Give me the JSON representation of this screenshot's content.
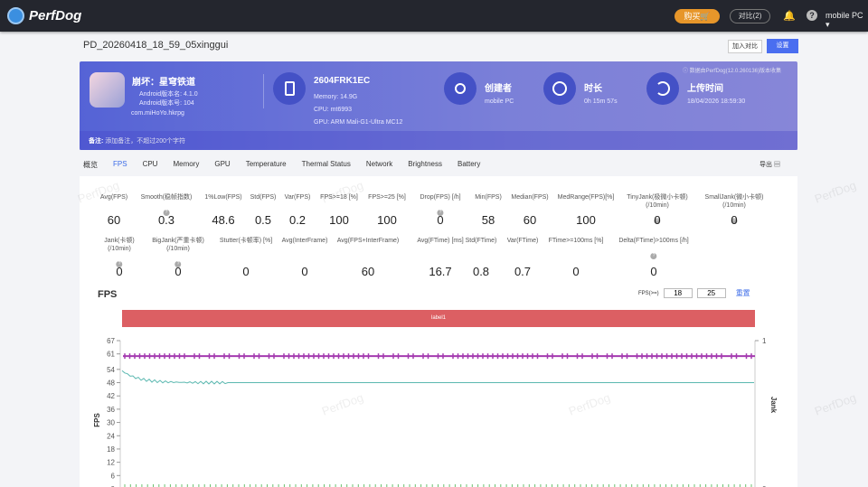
{
  "topbar": {
    "brand": "PerfDog",
    "buy": "购买🛒",
    "compare": "对比(2)",
    "user": "mobile PC ▾"
  },
  "header": {
    "title": "PD_20260418_18_59_05xinggui",
    "add_compare": "加入对比",
    "settings": "设置"
  },
  "banner": {
    "app_name": "崩坏：星穹铁道",
    "android_version_name": "Android版本名: 4.1.0",
    "android_version_code": "Android版本号: 104",
    "package": "com.miHoYo.hkrpg",
    "device": "2604FRK1EC",
    "memory": "Memory: 14.9G",
    "cpu": "CPU: mt6993",
    "gpu": "GPU: ARM Mali-G1-Ultra MC12",
    "creator_label": "创建者",
    "creator": "mobile PC",
    "duration_label": "时长",
    "duration": "0h 15m 57s",
    "upload_label": "上传时间",
    "upload_time": "18/04/2026 18:59:30",
    "version_note": "ⓘ 数据由PerfDog(12.0.260136)版本收集",
    "note_label": "备注:",
    "note_placeholder": "添加备注，不超过200个字符"
  },
  "tabs": [
    "概览",
    "FPS",
    "CPU",
    "Memory",
    "GPU",
    "Temperature",
    "Thermal Status",
    "Network",
    "Brightness",
    "Battery"
  ],
  "export": "导出",
  "stats_row1": [
    {
      "label": "Avg(FPS)",
      "value": "60"
    },
    {
      "label": "Smooth(稳帧指数)",
      "value": "0.3",
      "help": true
    },
    {
      "label": "1%Low(FPS)",
      "value": "48.6"
    },
    {
      "label": "Std(FPS)",
      "value": "0.5"
    },
    {
      "label": "Var(FPS)",
      "value": "0.2"
    },
    {
      "label": "FPS>=18 [%]",
      "value": "100"
    },
    {
      "label": "FPS>=25 [%]",
      "value": "100"
    },
    {
      "label": "Drop(FPS) [/h]",
      "value": "0",
      "help": true
    },
    {
      "label": "Min(FPS)",
      "value": "58"
    },
    {
      "label": "Median(FPS)",
      "value": "60"
    },
    {
      "label": "MedRange(FPS)[%]",
      "value": "100"
    },
    {
      "label": "TinyJank(极微小卡顿)\n(/10min)",
      "value": "0",
      "help": true
    },
    {
      "label": "SmallJank(微小卡顿)\n(/10min)",
      "value": "0",
      "help": true
    }
  ],
  "stats_row2": [
    {
      "label": "Jank(卡顿)\n(/10min)",
      "value": "0",
      "help": true
    },
    {
      "label": "BigJank(严重卡顿)\n(/10min)",
      "value": "0",
      "help": true
    },
    {
      "label": "Stutter(卡顿率) [%]",
      "value": "0"
    },
    {
      "label": "Avg(InterFrame)",
      "value": "0"
    },
    {
      "label": "Avg(FPS+InterFrame)",
      "value": "60"
    },
    {
      "label": "Avg(FTime) [ms]",
      "value": "16.7"
    },
    {
      "label": "Std(FTime)",
      "value": "0.8"
    },
    {
      "label": "Var(FTime)",
      "value": "0.7"
    },
    {
      "label": "FTime>=100ms [%]",
      "value": "0"
    },
    {
      "label": "Delta(FTime)>100ms [/h]",
      "value": "0",
      "help": true
    }
  ],
  "fps_section": {
    "title": "FPS",
    "threshold_label": "FPS(>=)",
    "threshold1": "18",
    "threshold2": "25",
    "reset": "重置",
    "label_bar": "label1"
  },
  "chart_data": {
    "type": "line",
    "ylabel": "FPS",
    "y2label": "Jank",
    "ylim": [
      0,
      67
    ],
    "yticks": [
      "67",
      "61",
      "54",
      "48",
      "42",
      "36",
      "30",
      "24",
      "18",
      "12",
      "6",
      "0"
    ],
    "y2ticks": [
      "1",
      "0"
    ],
    "series": [
      {
        "name": "FPS",
        "color": "#a43bb0",
        "approx_value": 60
      },
      {
        "name": "1%Low FPS",
        "color": "#5bb8b0",
        "start": 54,
        "settle": 48
      },
      {
        "name": "Jank markers",
        "color": "#6cc070",
        "value": 0
      }
    ]
  },
  "watermark": "PerfDog"
}
